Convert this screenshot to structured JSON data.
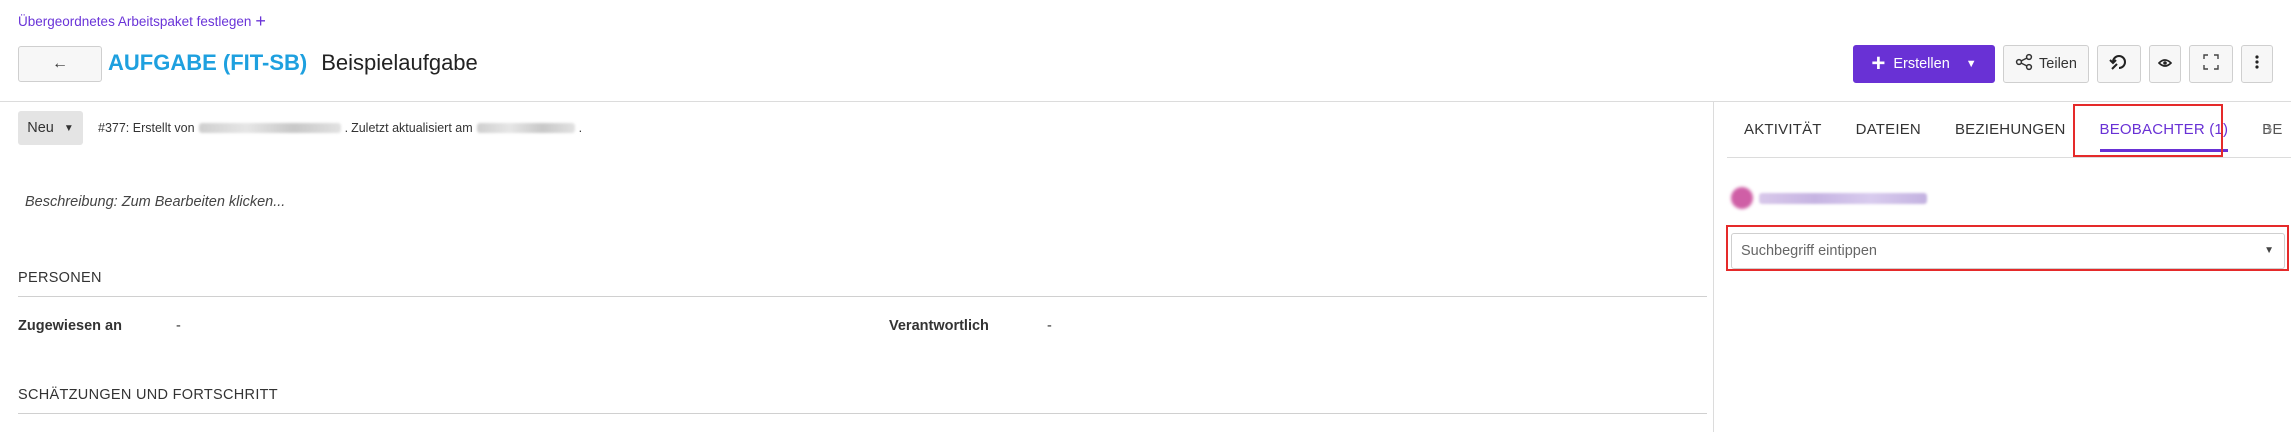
{
  "header": {
    "parent_link": "Übergeordnetes Arbeitspaket festlegen",
    "back_icon": "back-arrow-icon",
    "type": "AUFGABE (FIT-SB)",
    "subject": "Beispielaufgabe"
  },
  "toolbar": {
    "create_label": "Erstellen",
    "share_label": "Teilen",
    "icons": [
      "plus-icon",
      "share-icon",
      "activity-history-icon",
      "eye-icon",
      "fullscreen-icon",
      "more-vertical-icon"
    ]
  },
  "status": {
    "label": "Neu"
  },
  "meta": {
    "created_prefix": "#377: Erstellt von",
    "updated_prefix": "Zuletzt aktualisiert am"
  },
  "description": {
    "placeholder": "Beschreibung: Zum Bearbeiten klicken..."
  },
  "sections": {
    "persons": {
      "title": "PERSONEN",
      "assignee_label": "Zugewiesen an",
      "assignee_value": "-",
      "responsible_label": "Verantwortlich",
      "responsible_value": "-"
    },
    "estimates": {
      "title": "SCHÄTZUNGEN UND FORTSCHRITT"
    }
  },
  "side_panel": {
    "tabs": [
      {
        "label": "AKTIVITÄT"
      },
      {
        "label": "DATEIEN"
      },
      {
        "label": "BEZIEHUNGEN"
      },
      {
        "label": "BEOBACHTER (1)"
      },
      {
        "label": "BE"
      }
    ],
    "active_tab": "BEOBACHTER (1)",
    "watcher_search_placeholder": "Suchbegriff eintippen"
  },
  "colors": {
    "accent": "#6931d5",
    "type_blue": "#1ea0df",
    "highlight_red": "#e52a2a"
  }
}
